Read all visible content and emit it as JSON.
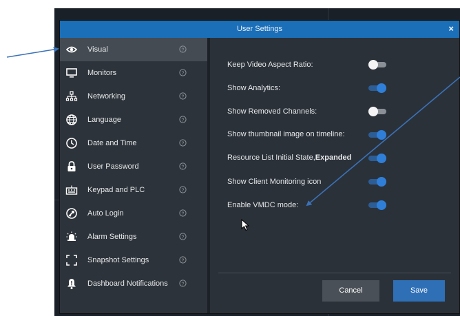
{
  "dialog": {
    "title": "User Settings",
    "close_label": "×"
  },
  "sidebar": {
    "items": [
      {
        "label": "Visual",
        "icon": "eye-icon",
        "active": true
      },
      {
        "label": "Monitors",
        "icon": "monitor-icon"
      },
      {
        "label": "Networking",
        "icon": "network-icon"
      },
      {
        "label": "Language",
        "icon": "globe-icon"
      },
      {
        "label": "Date and Time",
        "icon": "clock-icon"
      },
      {
        "label": "User Password",
        "icon": "lock-icon"
      },
      {
        "label": "Keypad and PLC",
        "icon": "keypad-icon"
      },
      {
        "label": "Auto Login",
        "icon": "key-icon"
      },
      {
        "label": "Alarm Settings",
        "icon": "alarm-icon"
      },
      {
        "label": "Snapshot Settings",
        "icon": "snapshot-icon"
      },
      {
        "label": "Dashboard Notifications",
        "icon": "bell-icon"
      }
    ],
    "help_icon": "help-icon"
  },
  "settings": [
    {
      "label": "Keep Video Aspect Ratio:",
      "on": false
    },
    {
      "label": "Show Analytics:",
      "on": true
    },
    {
      "label": "Show Removed Channels:",
      "on": false
    },
    {
      "label": "Show thumbnail image on timeline:",
      "on": true
    },
    {
      "label": "Resource List Initial State,",
      "label_bold": "Expanded",
      "on": true
    },
    {
      "label": "Show Client Monitoring icon",
      "on": true
    },
    {
      "label": "Enable VMDC mode:",
      "on": true
    }
  ],
  "footer": {
    "cancel_label": "Cancel",
    "save_label": "Save"
  },
  "colors": {
    "accent": "#1b6fb8",
    "toggle_on": "#2f7fd9",
    "annotation_arrow": "#3a72b8"
  }
}
